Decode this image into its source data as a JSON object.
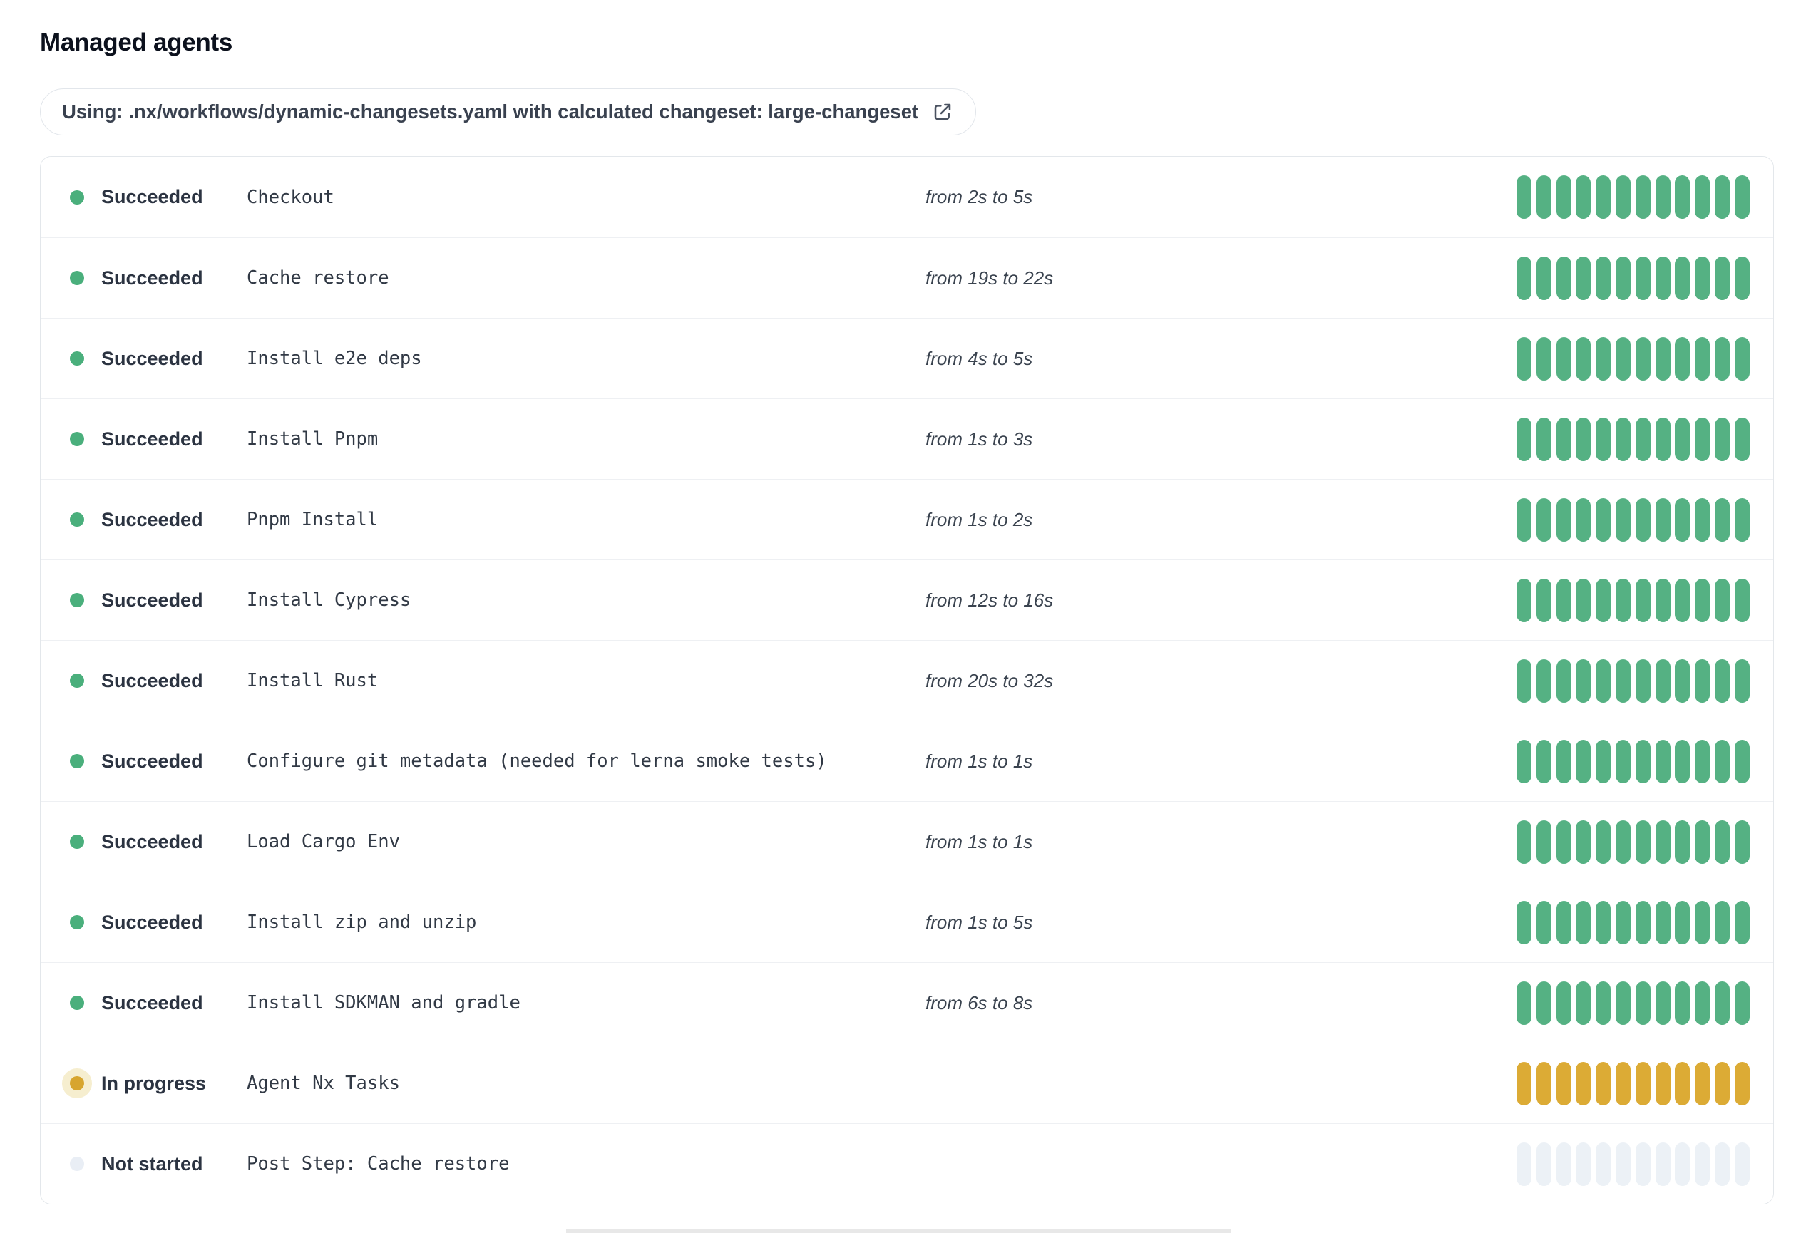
{
  "page": {
    "title": "Managed agents"
  },
  "banner": {
    "text": "Using: .nx/workflows/dynamic-changesets.yaml with calculated changeset: large-changeset",
    "icon": "external-link-icon"
  },
  "colors": {
    "succeeded_dot": "#4aaf7c",
    "succeeded_bar": "#55b183",
    "in_progress_dot": "#d7a52e",
    "in_progress_halo": "#f6eecf",
    "in_progress_bar": "#dcab35",
    "not_started_dot": "#e9eef5",
    "not_started_bar": "#ecf1f6"
  },
  "agents": {
    "bars_per_row": 12,
    "rows": [
      {
        "status": "Succeeded",
        "status_key": "succeeded",
        "name": "Checkout",
        "duration": "from 2s to 5s"
      },
      {
        "status": "Succeeded",
        "status_key": "succeeded",
        "name": "Cache restore",
        "duration": "from 19s to 22s"
      },
      {
        "status": "Succeeded",
        "status_key": "succeeded",
        "name": "Install e2e deps",
        "duration": "from 4s to 5s"
      },
      {
        "status": "Succeeded",
        "status_key": "succeeded",
        "name": "Install Pnpm",
        "duration": "from 1s to 3s"
      },
      {
        "status": "Succeeded",
        "status_key": "succeeded",
        "name": "Pnpm Install",
        "duration": "from 1s to 2s"
      },
      {
        "status": "Succeeded",
        "status_key": "succeeded",
        "name": "Install Cypress",
        "duration": "from 12s to 16s"
      },
      {
        "status": "Succeeded",
        "status_key": "succeeded",
        "name": "Install Rust",
        "duration": "from 20s to 32s"
      },
      {
        "status": "Succeeded",
        "status_key": "succeeded",
        "name": "Configure git metadata (needed for lerna smoke tests)",
        "duration": "from 1s to 1s"
      },
      {
        "status": "Succeeded",
        "status_key": "succeeded",
        "name": "Load Cargo Env",
        "duration": "from 1s to 1s"
      },
      {
        "status": "Succeeded",
        "status_key": "succeeded",
        "name": "Install zip and unzip",
        "duration": "from 1s to 5s"
      },
      {
        "status": "Succeeded",
        "status_key": "succeeded",
        "name": "Install SDKMAN and gradle",
        "duration": "from 6s to 8s"
      },
      {
        "status": "In progress",
        "status_key": "in-progress",
        "name": "Agent Nx Tasks",
        "duration": ""
      },
      {
        "status": "Not started",
        "status_key": "not-started",
        "name": "Post Step: Cache restore",
        "duration": ""
      }
    ]
  }
}
